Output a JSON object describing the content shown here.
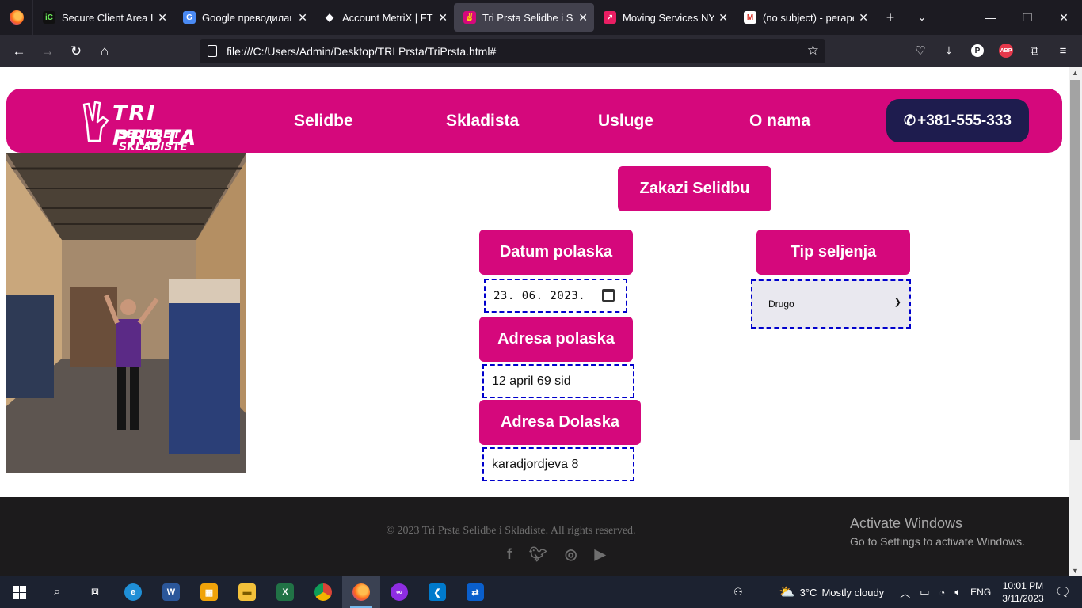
{
  "browser": {
    "tabs": [
      {
        "title": "Secure Client Area Log",
        "favicon": "ic-favicon",
        "fav_color": "#111111",
        "active": false
      },
      {
        "title": "Google преводилац",
        "favicon": "google-translate-favicon",
        "fav_color": "#4a8af4",
        "active": false
      },
      {
        "title": "Account MetriX | FTMO",
        "favicon": "ftmo-favicon",
        "fav_color": "#1c1b22",
        "active": false
      },
      {
        "title": "Tri Prsta Selidbe i Sklad",
        "favicon": "hand-favicon",
        "fav_color": "#d5087c",
        "active": true
      },
      {
        "title": "Moving Services NYC -",
        "favicon": "moving-favicon",
        "fav_color": "#e91e63",
        "active": false
      },
      {
        "title": "(no subject) - perapetr",
        "favicon": "gmail-favicon",
        "fav_color": "#ffffff",
        "active": false
      }
    ],
    "url": "file:///C:/Users/Admin/Desktop/TRI Prsta/TriPrsta.html#"
  },
  "site": {
    "logo_line1": "TRI PRSTA",
    "logo_line2": "SELIDBE I SKLADISTE",
    "menu": [
      "Selidbe",
      "Skladista",
      "Usluge",
      "O nama"
    ],
    "phone": "+381-555-333",
    "brand_color": "#d5087c"
  },
  "form": {
    "schedule_button": "Zakazi Selidbu",
    "departure_date_label": "Datum polaska",
    "departure_date_value": "23. 06. 2023.",
    "move_type_label": "Tip seljenja",
    "move_type_value": "Drugo",
    "departure_address_label": "Adresa polaska",
    "departure_address_value": "12 april 69 sid",
    "arrival_address_label": "Adresa Dolaska",
    "arrival_address_value": "karadjordjeva 8"
  },
  "footer": {
    "copyright": "© 2023 Tri Prsta Selidbe i Skladiste. All rights reserved.",
    "socials": [
      "facebook-icon",
      "twitter-icon",
      "instagram-icon",
      "youtube-icon"
    ]
  },
  "watermark": {
    "title": "Activate Windows",
    "subtitle": "Go to Settings to activate Windows."
  },
  "taskbar": {
    "weather_temp": "3°C",
    "weather_desc": "Mostly cloudy",
    "language": "ENG",
    "time": "10:01 PM",
    "date": "3/11/2023"
  }
}
